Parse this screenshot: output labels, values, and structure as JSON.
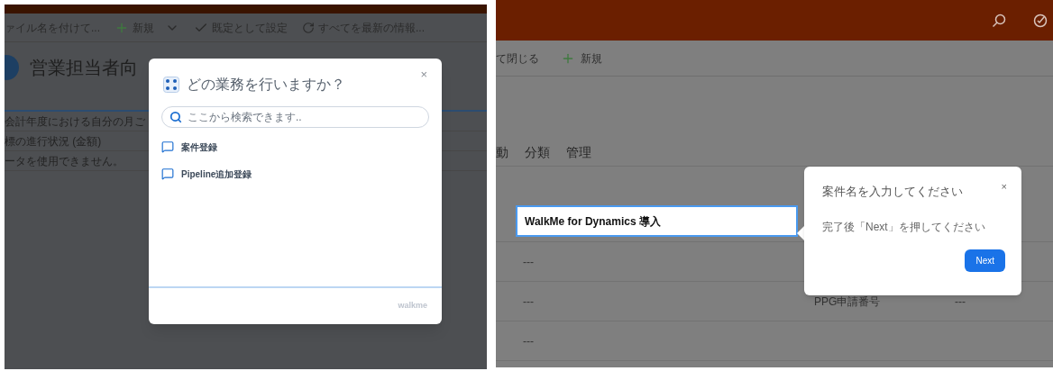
{
  "left_screen": {
    "toolbar": [
      {
        "label": "ァイル名を付けて...",
        "kind": "text"
      },
      {
        "label": "新規",
        "kind": "new"
      },
      {
        "label": "既定として設定",
        "kind": "check"
      },
      {
        "label": "すべてを最新の情報...",
        "kind": "refresh"
      }
    ],
    "title": "営業担当者向",
    "rows": [
      "会計年度における自分の月ご",
      "標の進行状況 (金額)",
      "ータを使用できません。"
    ],
    "dialog": {
      "title": "どの業務を行いますか？",
      "close": "×",
      "search": {
        "placeholder": "ここから検索できます.."
      },
      "items": [
        {
          "label": "案件登録"
        },
        {
          "label": "Pipeline追加登録"
        }
      ],
      "logo_text": "walkme"
    }
  },
  "right_screen": {
    "toolbar": [
      {
        "label": "て閉じる",
        "kind": "text"
      },
      {
        "label": "新規",
        "kind": "add"
      }
    ],
    "tabs": [
      "動",
      "分類",
      "管理"
    ],
    "field": {
      "value": "WalkMe for Dynamics 導入"
    },
    "rows": [
      {
        "left": "---"
      },
      {
        "left": "---",
        "label": "PPG申請番号",
        "value": "---"
      },
      {
        "left": "---"
      }
    ],
    "popover": {
      "title": "案件名を入力してください",
      "close": "×",
      "body": "完了後「Next」を押してください",
      "button": "Next"
    }
  }
}
